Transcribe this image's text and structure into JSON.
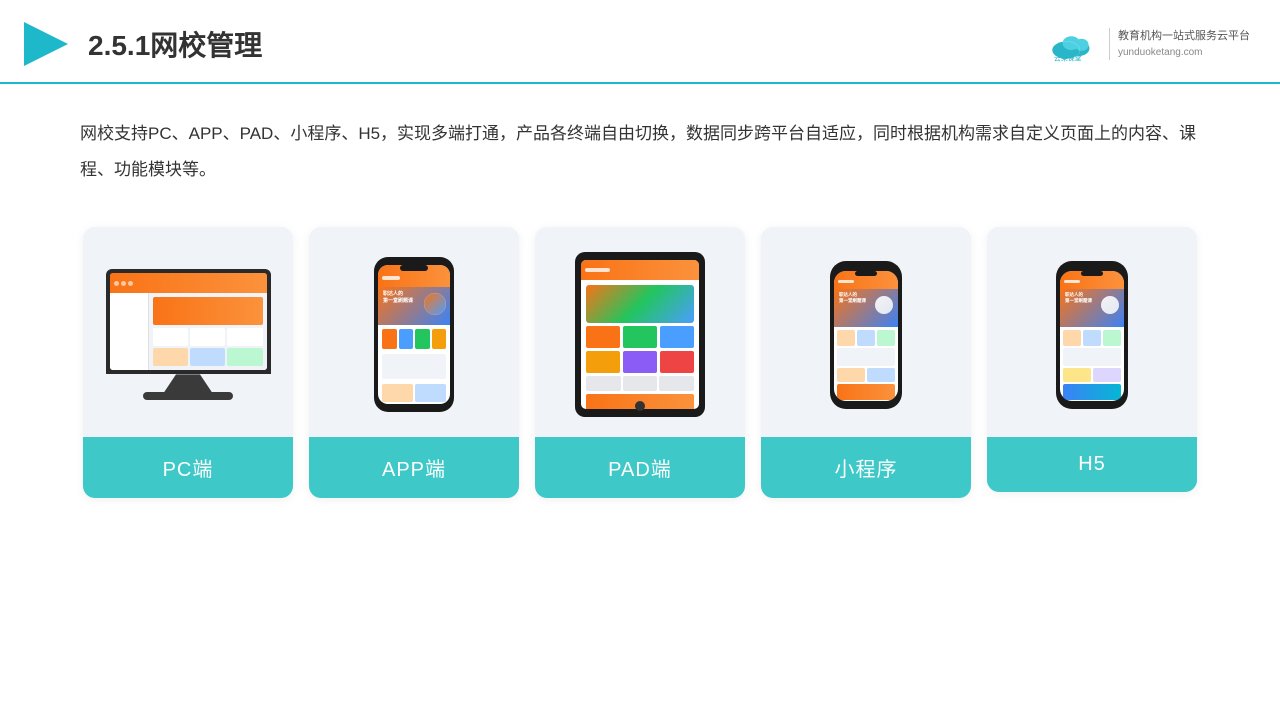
{
  "header": {
    "title": "2.5.1网校管理",
    "logo": {
      "name": "云朵课堂",
      "domain": "yunduoketang.com",
      "tagline": "教育机构一站式服务云平台"
    }
  },
  "description": "网校支持PC、APP、PAD、小程序、H5，实现多端打通，产品各终端自由切换，数据同步跨平台自适应，同时根据机构需求自定义页面上的内容、课程、功能模块等。",
  "cards": [
    {
      "id": "pc",
      "label": "PC端"
    },
    {
      "id": "app",
      "label": "APP端"
    },
    {
      "id": "pad",
      "label": "PAD端"
    },
    {
      "id": "miniapp",
      "label": "小程序"
    },
    {
      "id": "h5",
      "label": "H5"
    }
  ],
  "colors": {
    "accent": "#3ec8c8",
    "headerBorder": "#1db8c9",
    "cardBg": "#f0f4f8"
  }
}
